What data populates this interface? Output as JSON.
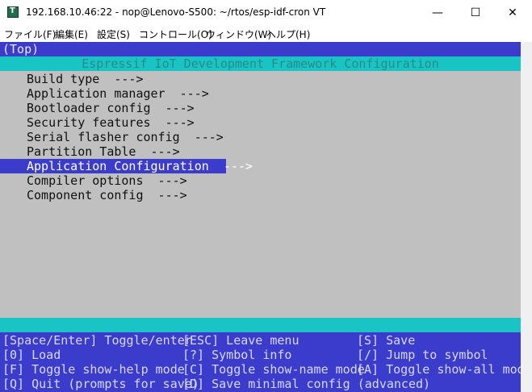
{
  "window": {
    "title": "192.168.10.46:22 - nop@Lenovo-S500: ~/rtos/esp-idf-cron VT",
    "minimize": "—",
    "maximize": "☐",
    "close": "✕"
  },
  "menubar": {
    "file": "ファイル(F)",
    "edit": "編集(E)",
    "settings": "設定(S)",
    "control": "コントロール(O)",
    "window": "ウィンドウ(W)",
    "help": "ヘルプ(H)"
  },
  "terminal": {
    "breadcrumb": "(Top)",
    "header": "Espressif IoT Development Framework Configuration",
    "items": [
      "Build type  --->",
      "Application manager  --->",
      "Bootloader config  --->",
      "Security features  --->",
      "Serial flasher config  --->",
      "Partition Table  --->",
      "Application Configuration  --->",
      "Compiler options  --->",
      "Component config  --->"
    ],
    "selected_index": 6,
    "help": {
      "col1": [
        "[Space/Enter] Toggle/enter",
        "[0] Load",
        "[F] Toggle show-help mode",
        "[Q] Quit (prompts for save)"
      ],
      "col2": [
        "[ESC] Leave menu",
        "[?] Symbol info",
        "[C] Toggle show-name mode",
        "[D] Save minimal config (advanced)"
      ],
      "col3": [
        "[S] Save",
        "[/] Jump to symbol",
        "[A] Toggle show-all mode",
        ""
      ]
    }
  }
}
